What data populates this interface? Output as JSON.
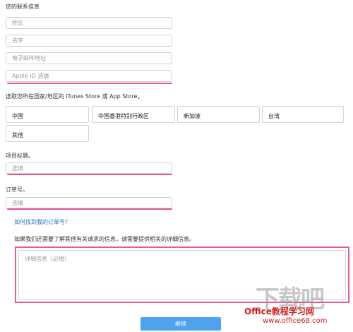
{
  "contact": {
    "heading": "您的联系信息",
    "surname_placeholder": "姓氏",
    "given_name_placeholder": "名字",
    "email_placeholder": "电子邮件地址",
    "apple_id_placeholder": "Apple ID 选填"
  },
  "region": {
    "prompt": "选取您所在国家/地区的 iTunes Store 或 App Store。",
    "options": [
      "中国",
      "中国香港特别行政区",
      "新加坡",
      "台湾",
      "其他"
    ]
  },
  "project": {
    "label": "项目标题。",
    "placeholder": "选填"
  },
  "order": {
    "label": "订单号。",
    "placeholder": "选填",
    "help_link": "如何找到我的订单号？"
  },
  "details": {
    "prompt": "如果我们还需要了解其他有关请求的信息，请需要提供相关的详细信息。",
    "placeholder": "详细信息（必填）"
  },
  "actions": {
    "continue_label": "继续"
  },
  "watermark": {
    "office_text": "Office教程学习网",
    "url_text": "www.office68.com",
    "big_text": "下载吧"
  },
  "colors": {
    "highlight": "#e8569a",
    "link": "#1a73c4",
    "button": "#4ea2ee"
  }
}
